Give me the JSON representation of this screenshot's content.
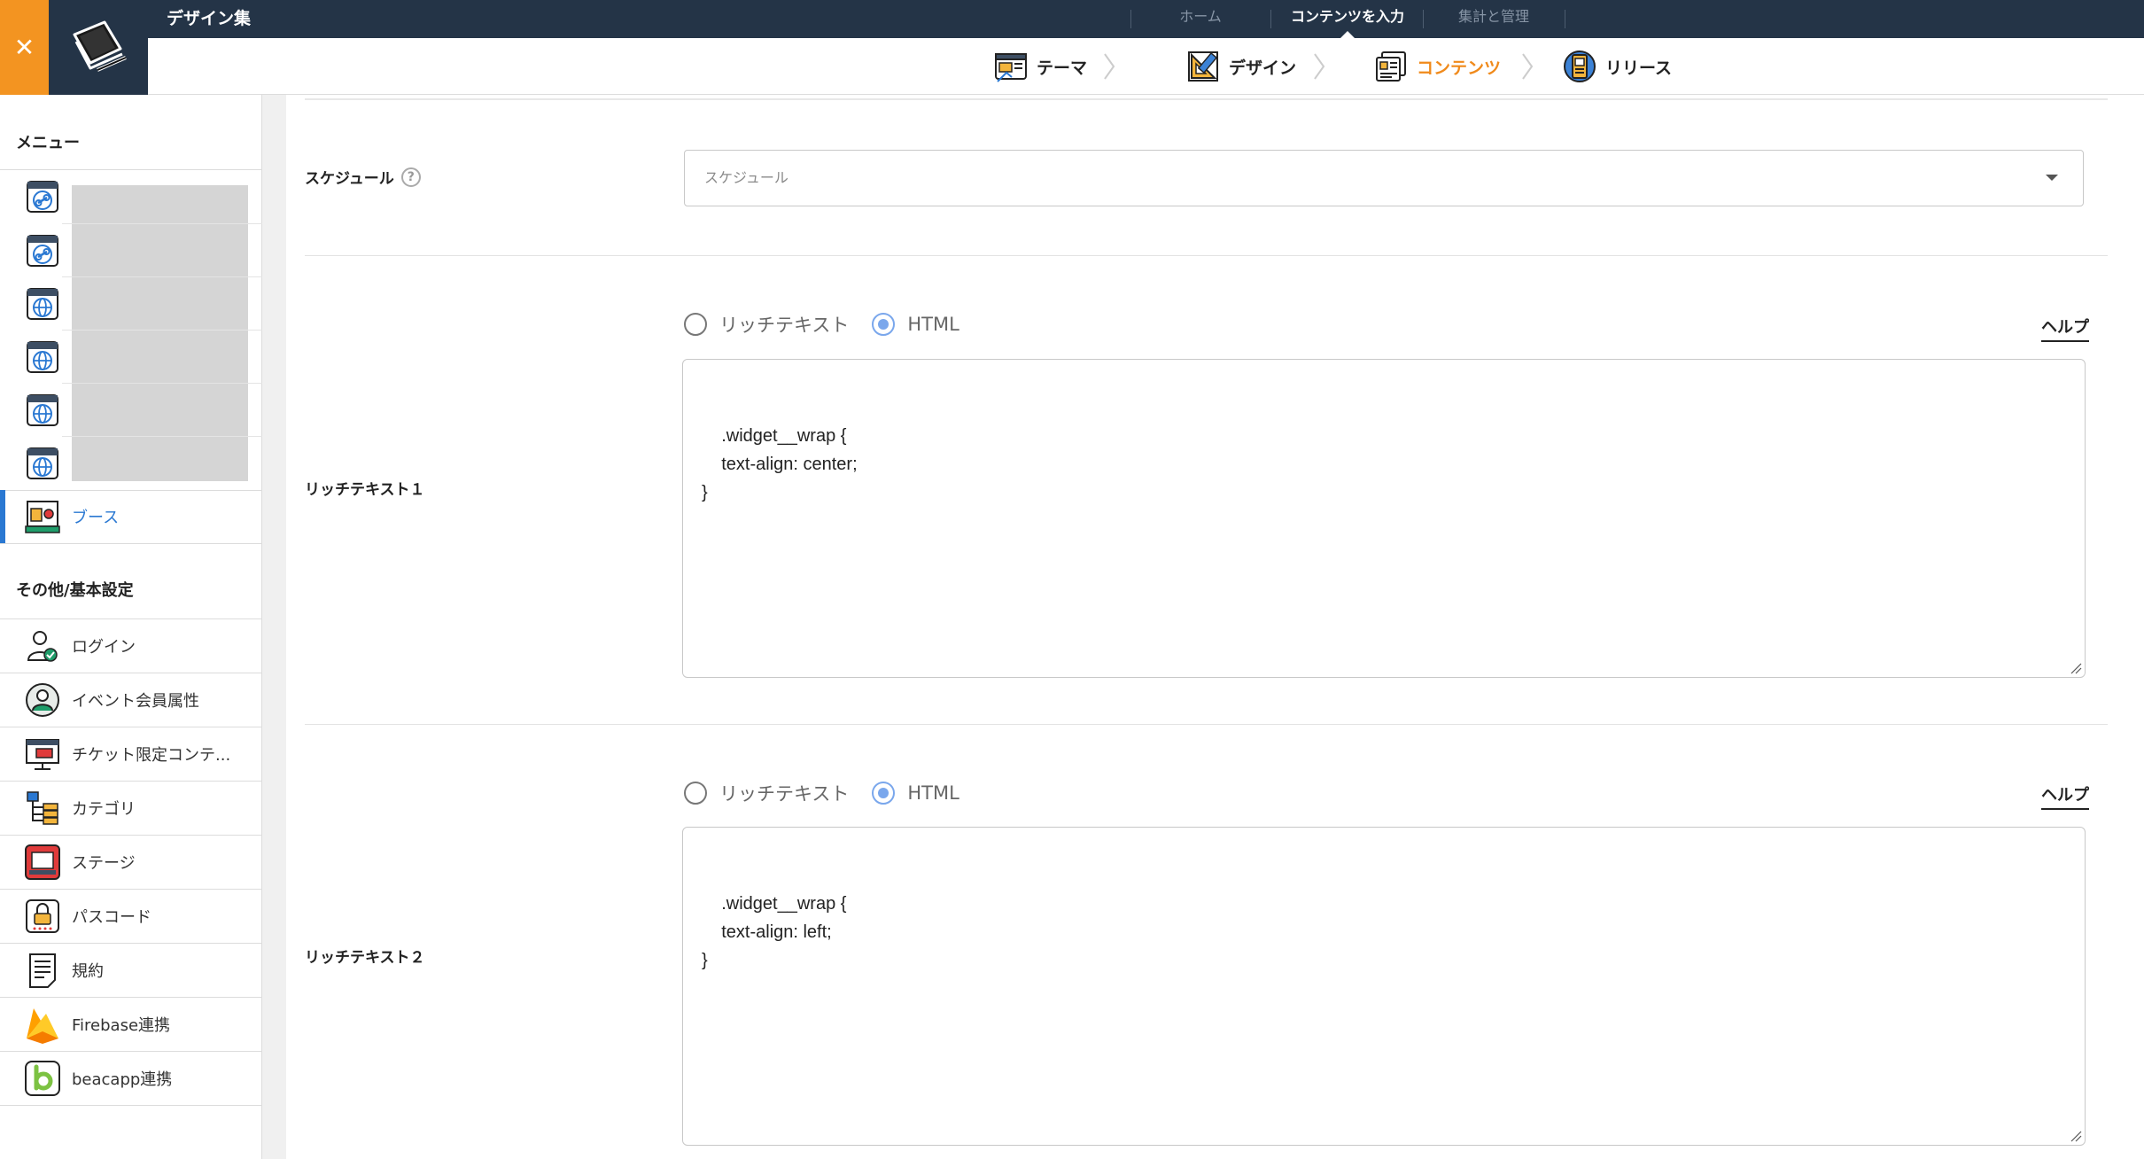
{
  "app": {
    "title": "デザイン集"
  },
  "topnav": {
    "items": [
      {
        "label": "ホーム",
        "active": false
      },
      {
        "label": "コンテンツを入力",
        "active": true
      },
      {
        "label": "集計と管理",
        "active": false
      }
    ]
  },
  "steps": [
    {
      "label": "テーマ",
      "icon": "theme-icon",
      "active": false
    },
    {
      "label": "デザイン",
      "icon": "design-ruler-icon",
      "active": false
    },
    {
      "label": "コンテンツ",
      "icon": "contents-icon",
      "active": true
    },
    {
      "label": "リリース",
      "icon": "release-icon",
      "active": false
    }
  ],
  "sidebar": {
    "menu_heading": "メニュー",
    "menu_items": [
      {
        "icon": "link-page-icon",
        "label": ""
      },
      {
        "icon": "link-page-icon",
        "label": ""
      },
      {
        "icon": "globe-page-icon",
        "label": ""
      },
      {
        "icon": "globe-page-icon",
        "label": ""
      },
      {
        "icon": "globe-page-icon",
        "label": ""
      },
      {
        "icon": "globe-page-icon",
        "label": ""
      },
      {
        "icon": "booth-icon",
        "label": "ブース",
        "active": true
      }
    ],
    "other_heading": "その他/基本設定",
    "other_items": [
      {
        "icon": "login-user-icon",
        "label": "ログイン"
      },
      {
        "icon": "member-attribute-icon",
        "label": "イベント会員属性"
      },
      {
        "icon": "ticket-content-icon",
        "label": "チケット限定コンテ..."
      },
      {
        "icon": "category-icon",
        "label": "カテゴリ"
      },
      {
        "icon": "stage-icon",
        "label": "ステージ"
      },
      {
        "icon": "passcode-lock-icon",
        "label": "パスコード"
      },
      {
        "icon": "terms-doc-icon",
        "label": "規約"
      },
      {
        "icon": "firebase-icon",
        "label": "Firebase連携"
      },
      {
        "icon": "beacapp-icon",
        "label": "beacapp連携"
      }
    ]
  },
  "form": {
    "schedule": {
      "label": "スケジュール",
      "placeholder": "スケジュール"
    },
    "richtext1": {
      "label": "リッチテキスト１",
      "radio_rich": "リッチテキスト",
      "radio_html": "HTML",
      "selected": "HTML",
      "help": "ヘルプ",
      "code": ".widget__wrap {\n    text-align: center;\n}"
    },
    "richtext2": {
      "label": "リッチテキスト２",
      "radio_rich": "リッチテキスト",
      "radio_html": "HTML",
      "selected": "HTML",
      "help": "ヘルプ",
      "code": ".widget__wrap {\n    text-align: left;\n}"
    }
  },
  "colors": {
    "topbar": "#243447",
    "accent_orange": "#f39421",
    "active_step": "#f08a1b",
    "active_link": "#2a78d2",
    "radio_checked": "#7aa7ec"
  }
}
